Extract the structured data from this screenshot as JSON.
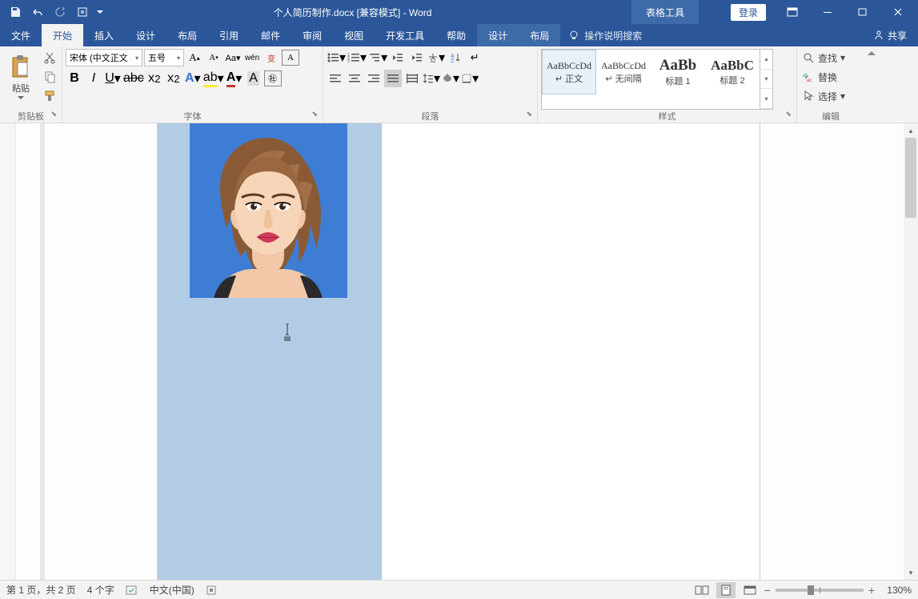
{
  "titlebar": {
    "doc_title": "个人简历制作.docx [兼容模式] - Word",
    "tools_context": "表格工具",
    "login": "登录"
  },
  "menu": {
    "file": "文件",
    "home": "开始",
    "insert": "插入",
    "design": "设计",
    "layout": "布局",
    "references": "引用",
    "mailings": "邮件",
    "review": "审阅",
    "view": "视图",
    "developer": "开发工具",
    "help": "帮助",
    "table_design": "设计",
    "table_layout": "布局",
    "tell_me": "操作说明搜索",
    "share": "共享"
  },
  "ribbon": {
    "clipboard": {
      "label": "剪贴板",
      "paste": "粘贴"
    },
    "font": {
      "label": "字体",
      "family": "宋体 (中文正文",
      "size": "五号",
      "phonetic": "wén",
      "ruby": "变"
    },
    "paragraph": {
      "label": "段落"
    },
    "styles": {
      "label": "样式",
      "items": [
        {
          "preview": "AaBbCcDd",
          "name": "↵ 正文"
        },
        {
          "preview": "AaBbCcDd",
          "name": "↵ 无间隔"
        },
        {
          "preview": "AaBb",
          "name": "标题 1"
        },
        {
          "preview": "AaBbC",
          "name": "标题 2"
        }
      ]
    },
    "editing": {
      "label": "编辑",
      "find": "查找",
      "replace": "替换",
      "select": "选择"
    }
  },
  "status": {
    "page": "第 1 页，共 2 页",
    "words": "4 个字",
    "lang": "中文(中国)",
    "zoom": "130%"
  }
}
